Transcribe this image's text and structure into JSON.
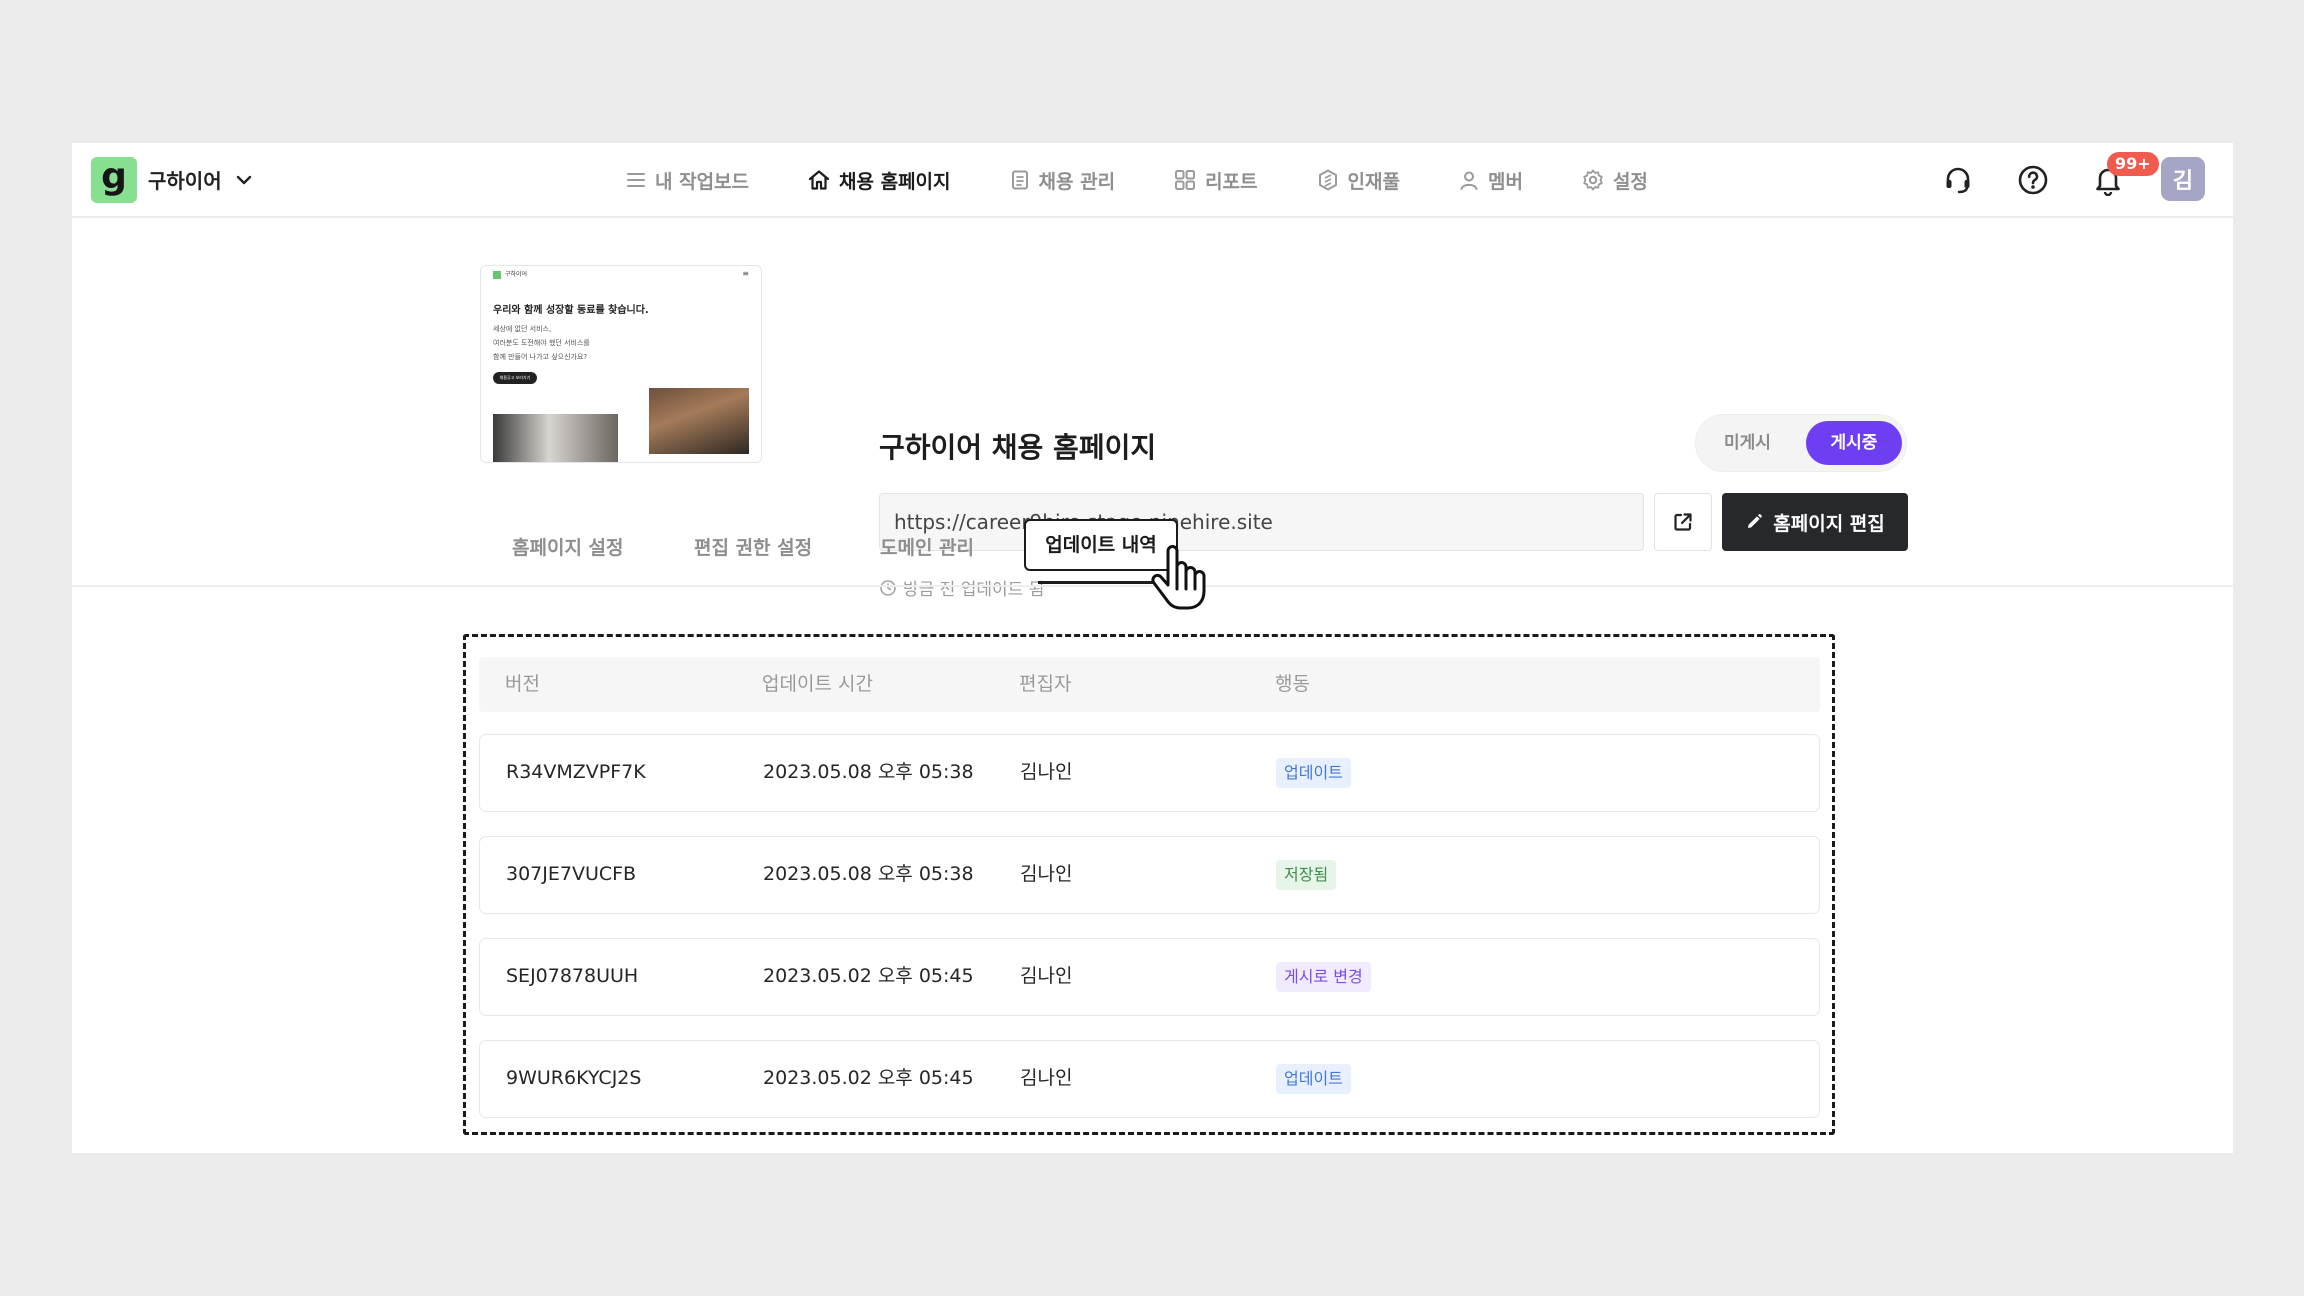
{
  "company": {
    "logo_letter": "g",
    "name": "구하이어"
  },
  "nav": {
    "items": [
      {
        "label": "내 작업보드",
        "icon": "list-icon"
      },
      {
        "label": "채용 홈페이지",
        "icon": "home-icon",
        "active": true
      },
      {
        "label": "채용 관리",
        "icon": "document-icon"
      },
      {
        "label": "리포트",
        "icon": "grid-icon"
      },
      {
        "label": "인재풀",
        "icon": "pool-icon"
      },
      {
        "label": "멤버",
        "icon": "user-icon"
      },
      {
        "label": "설정",
        "icon": "gear-icon"
      }
    ],
    "notification_badge": "99+",
    "avatar": "김"
  },
  "preview": {
    "brand": "구하이어",
    "headline": "우리와 함께 성장할 동료를 찾습니다.",
    "lines": [
      "세상에 없던 서비스,",
      "여러분도 도전해야 했던 서비스를",
      "함께 만들어 나가고 싶으신가요?"
    ],
    "button": "채용공고 보러가기"
  },
  "homepage": {
    "title": "구하이어 채용 홈페이지",
    "toggle_off": "미게시",
    "toggle_on": "게시중",
    "url": "https://career9hire.stage.ninehire.site",
    "edit_button": "홈페이지 편집",
    "updated_text": "방금 전 업데이트 됨"
  },
  "tabs": [
    {
      "label": "홈페이지 설정"
    },
    {
      "label": "편집 권한 설정"
    },
    {
      "label": "도메인 관리"
    },
    {
      "label": "업데이트 내역",
      "active": true
    }
  ],
  "table": {
    "headers": [
      "버전",
      "업데이트 시간",
      "편집자",
      "행동"
    ],
    "rows": [
      {
        "version": "R34VMZVPF7K",
        "time": "2023.05.08 오후 05:38",
        "editor": "김나인",
        "action": "업데이트",
        "action_color": "#4377d6"
      },
      {
        "version": "307JE7VUCFB",
        "time": "2023.05.08 오후 05:38",
        "editor": "김나인",
        "action": "저장됨",
        "action_color": "#3f8d4a"
      },
      {
        "version": "SEJ07878UUH",
        "time": "2023.05.02 오후 05:45",
        "editor": "김나인",
        "action": "게시로 변경",
        "action_color": "#7a4ee3"
      },
      {
        "version": "9WUR6KYCJ2S",
        "time": "2023.05.02 오후 05:45",
        "editor": "김나인",
        "action": "업데이트",
        "action_color": "#4377d6"
      }
    ]
  },
  "colors": {
    "accent": "#6d3ef2",
    "logo_bg": "#86e08f",
    "dark_button": "#26282c",
    "badge": "#f05a4f"
  }
}
